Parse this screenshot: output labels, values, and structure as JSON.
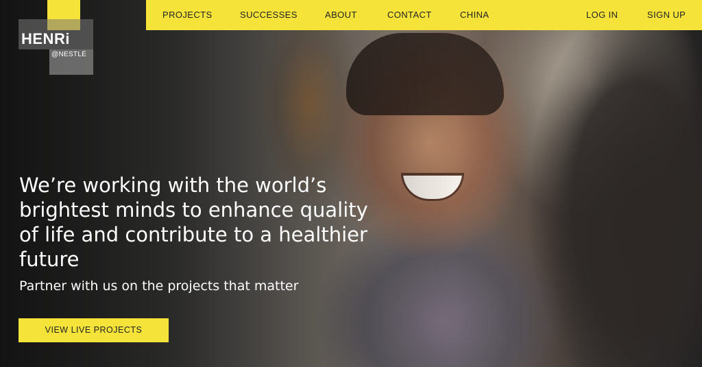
{
  "brand": {
    "logo_main": "HENRi",
    "logo_sub": "@NESTLÉ"
  },
  "nav": {
    "items": [
      {
        "label": "PROJECTS"
      },
      {
        "label": "SUCCESSES"
      },
      {
        "label": "ABOUT"
      },
      {
        "label": "CONTACT"
      },
      {
        "label": "CHINA"
      }
    ],
    "login_label": "LOG IN",
    "signup_label": "SIGN UP"
  },
  "hero": {
    "headline": "We’re working with the world’s brightest minds to enhance quality of life and contribute to a healthier future",
    "subheadline": "Partner with us on the projects that matter",
    "cta_label": "VIEW LIVE PROJECTS",
    "image_description": "smiling-man-photo"
  },
  "colors": {
    "accent": "#f6e33a",
    "nav_text": "#222222",
    "hero_text": "#ffffff"
  }
}
